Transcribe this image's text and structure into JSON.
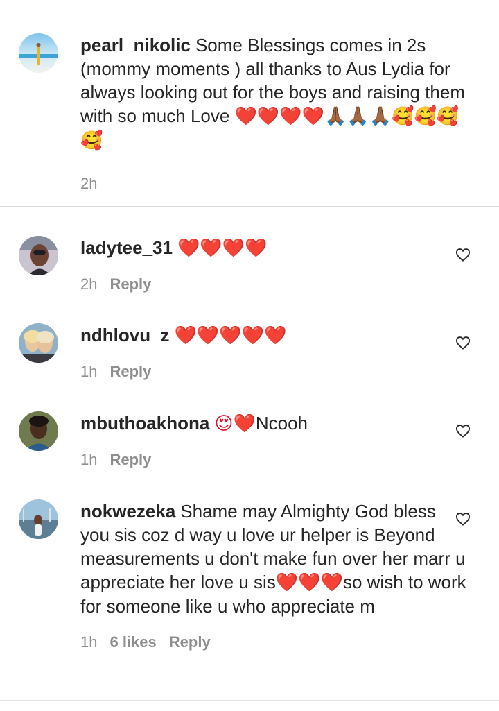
{
  "caption": {
    "username": "pearl_nikolic",
    "text": "Some Blessings comes in 2s (mommy moments ) all thanks to Aus Lydia for always looking out for the boys and raising them with so much Love",
    "emoji": "❤️❤️❤️❤️🙏🏾🙏🏾🙏🏾🥰🥰🥰🥰",
    "time": "2h"
  },
  "comments": [
    {
      "username": "ladytee_31",
      "text": "",
      "emoji": "❤️❤️❤️❤️",
      "time": "2h",
      "likes": "",
      "reply": "Reply"
    },
    {
      "username": "ndhlovu_z",
      "text": "",
      "emoji": "❤️❤️❤️❤️❤️",
      "time": "1h",
      "likes": "",
      "reply": "Reply"
    },
    {
      "username": "mbuthoakhona",
      "text": "Ncooh",
      "emoji": "😍❤️",
      "time": "1h",
      "likes": "",
      "reply": "Reply"
    },
    {
      "username": "nokwezeka",
      "text": "Shame may Almighty God bless you sis coz d way u love ur helper is Beyond measurements u don't make fun over her marr u appreciate her love u sis",
      "emoji_mid": "❤️❤️❤️",
      "text_tail": "so wish to work for someone like u who appreciate m",
      "time": "1h",
      "likes": "6 likes",
      "reply": "Reply"
    }
  ],
  "icons": {
    "like": "heart-outline-icon"
  },
  "colors": {
    "text": "#262626",
    "meta": "#8e8e8e",
    "heart": "#e8112d",
    "divider": "#dbdbdb"
  }
}
